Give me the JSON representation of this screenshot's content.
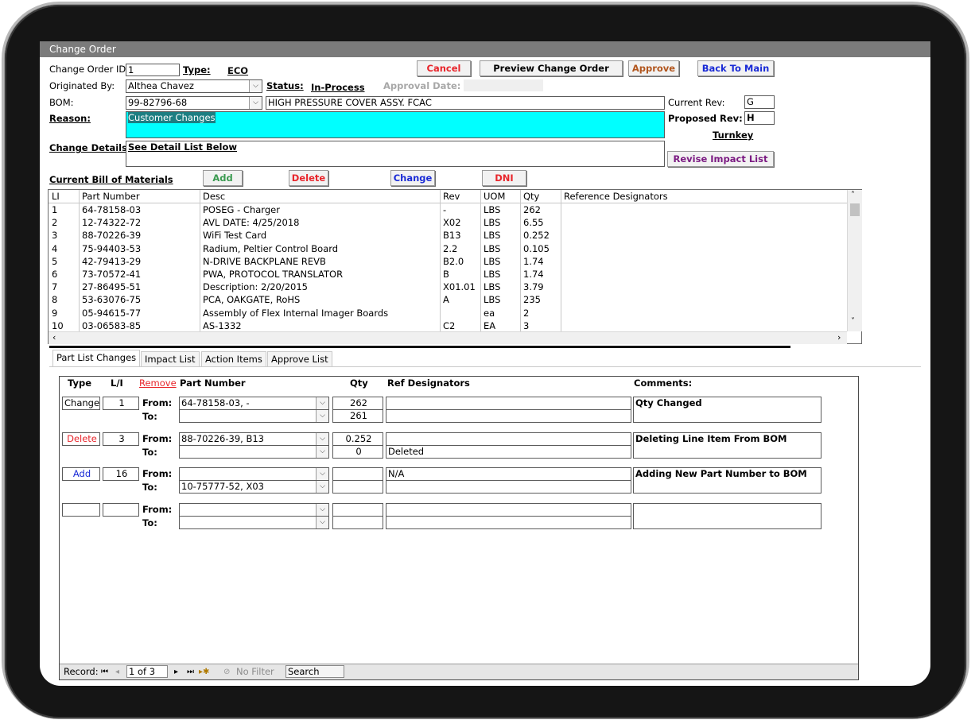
{
  "window": {
    "title": "Change Order"
  },
  "header": {
    "co_id_label": "Change Order ID",
    "co_id_value": "1",
    "type_label": "Type:",
    "type_value": "ECO",
    "originated_label": "Originated By:",
    "originated_value": "Althea Chavez",
    "status_label": "Status:",
    "status_value": "In-Process",
    "approval_date_label": "Approval Date:",
    "bom_label": "BOM:",
    "bom_value": "99-82796-68",
    "bom_desc": "HIGH PRESSURE COVER ASSY. FCAC",
    "current_rev_label": "Current Rev:",
    "current_rev_value": "G",
    "proposed_rev_label": "Proposed Rev:",
    "proposed_rev_value": "H",
    "turnkey": "Turnkey",
    "reason_label": "Reason:",
    "reason_value": "Customer Changes",
    "details_label": "Change Details",
    "details_value": "See Detail List Below"
  },
  "buttons": {
    "cancel": "Cancel",
    "preview": "Preview Change Order",
    "approve": "Approve",
    "back": "Back To Main",
    "revise": "Revise Impact List",
    "add": "Add",
    "delete": "Delete",
    "change": "Change",
    "dni": "DNI"
  },
  "colors": {
    "cancel": "#e8252b",
    "approve": "#b1561e",
    "back": "#1a2bd6",
    "revise": "#7b1a82",
    "add": "#3a9a50",
    "delete": "#e8252b",
    "change": "#1a2bd6",
    "dni": "#e8252b",
    "reason_bg": "#00ffff"
  },
  "bom": {
    "section_label": "Current Bill of Materials",
    "columns": [
      "LI",
      "Part Number",
      "Desc",
      "Rev",
      "UOM",
      "Qty",
      "Reference Designators"
    ],
    "rows": [
      [
        "1",
        "64-78158-03",
        "POSEG - Charger",
        "-",
        "LBS",
        "262"
      ],
      [
        "2",
        "12-74322-72",
        "AVL DATE: 4/25/2018",
        "X02",
        "LBS",
        "6.55"
      ],
      [
        "3",
        "88-70226-39",
        "WiFi Test Card",
        "B13",
        "LBS",
        "0.252"
      ],
      [
        "4",
        "75-94403-53",
        "Radium, Peltier Control Board",
        "2.2",
        "LBS",
        "0.105"
      ],
      [
        "5",
        "42-79413-29",
        "N-DRIVE BACKPLANE REVB",
        "B2.0",
        "LBS",
        "1.74"
      ],
      [
        "6",
        "73-70572-41",
        "PWA, PROTOCOL TRANSLATOR",
        "B",
        "LBS",
        "1.74"
      ],
      [
        "7",
        "27-86495-51",
        "Description:  2/20/2015",
        "X01.01",
        "LBS",
        "3.79"
      ],
      [
        "8",
        "53-63076-75",
        "PCA, OAKGATE, RoHS",
        "A",
        "LBS",
        "235"
      ],
      [
        "9",
        "05-94615-77",
        "Assembly of Flex Internal Imager Boards",
        "",
        "ea",
        "2"
      ],
      [
        "10",
        "03-06583-85",
        "AS-1332",
        "C2",
        "EA",
        "3"
      ]
    ]
  },
  "tabs": [
    "Part List Changes",
    "Impact List",
    "Action Items",
    "Approve List"
  ],
  "changes": {
    "headers": {
      "type": "Type",
      "li": "L/I",
      "remove": "Remove",
      "part": "Part Number",
      "qty": "Qty",
      "ref": "Ref Designators",
      "comments": "Comments:"
    },
    "from_label": "From:",
    "to_label": "To:",
    "rows": [
      {
        "type": "Change",
        "type_color": "#000000",
        "li": "1",
        "from_part": "64-78158-03, -",
        "to_part": "",
        "from_qty": "262",
        "to_qty": "261",
        "from_ref": "",
        "to_ref": "",
        "comment": "Qty Changed"
      },
      {
        "type": "Delete",
        "type_color": "#e8252b",
        "li": "3",
        "from_part": "88-70226-39, B13",
        "to_part": "",
        "from_qty": "0.252",
        "to_qty": "0",
        "from_ref": "",
        "to_ref": "Deleted",
        "comment": "Deleting Line Item From BOM"
      },
      {
        "type": "Add",
        "type_color": "#1a2bd6",
        "li": "16",
        "from_part": "",
        "to_part": "10-75777-52, X03",
        "from_qty": "",
        "to_qty": "",
        "from_ref": "N/A",
        "to_ref": "",
        "comment": "Adding New Part Number to BOM"
      },
      {
        "type": "",
        "type_color": "#000000",
        "li": "",
        "from_part": "",
        "to_part": "",
        "from_qty": "",
        "to_qty": "",
        "from_ref": "",
        "to_ref": "",
        "comment": ""
      }
    ]
  },
  "record_nav": {
    "label": "Record:",
    "position": "1 of 3",
    "filter": "No Filter",
    "search": "Search"
  }
}
